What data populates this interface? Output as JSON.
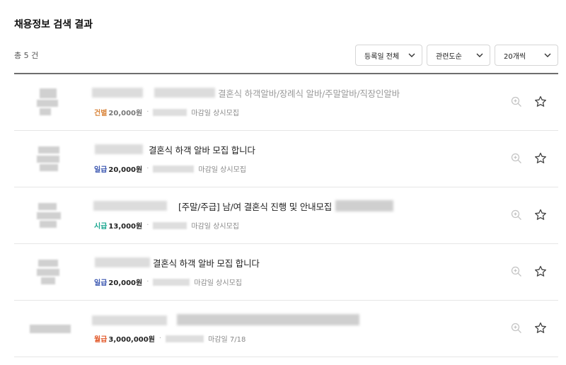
{
  "page": {
    "title": "채용정보 검색 결과",
    "total_label": "총 5 건"
  },
  "filters": [
    {
      "label": "등록일 전체",
      "icon": "chevron-down-icon"
    },
    {
      "label": "관련도순",
      "icon": "chevron-down-icon"
    },
    {
      "label": "20개씩",
      "icon": "chevron-down-icon"
    }
  ],
  "colors": {
    "weekly": "#d9843a",
    "daily": "#3a56b0",
    "hourly": "#1aa68f",
    "monthly": "#e25a2b"
  },
  "listings": [
    {
      "title": "결혼식 하객알바/장례식 알바/주말알바/직장인알바",
      "pay_type": "건별",
      "pay_amount": "20,000원",
      "deadline": "마감일 상시모집",
      "faded": true
    },
    {
      "title": "결혼식 하객 알바 모집 합니다",
      "pay_type": "일급",
      "pay_amount": "20,000원",
      "deadline": "마감일 상시모집",
      "faded": false
    },
    {
      "title": "[주말/주급] 남/여 결혼식 진행 및 안내모집",
      "pay_type": "시급",
      "pay_amount": "13,000원",
      "deadline": "마감일 상시모집",
      "faded": false
    },
    {
      "title": "결혼식 하객 알바 모집 합니다",
      "pay_type": "일급",
      "pay_amount": "20,000원",
      "deadline": "마감일 상시모집",
      "faded": false
    },
    {
      "title": "",
      "pay_type": "월급",
      "pay_amount": "3,000,000원",
      "deadline": "마감일 7/18",
      "faded": false
    }
  ]
}
